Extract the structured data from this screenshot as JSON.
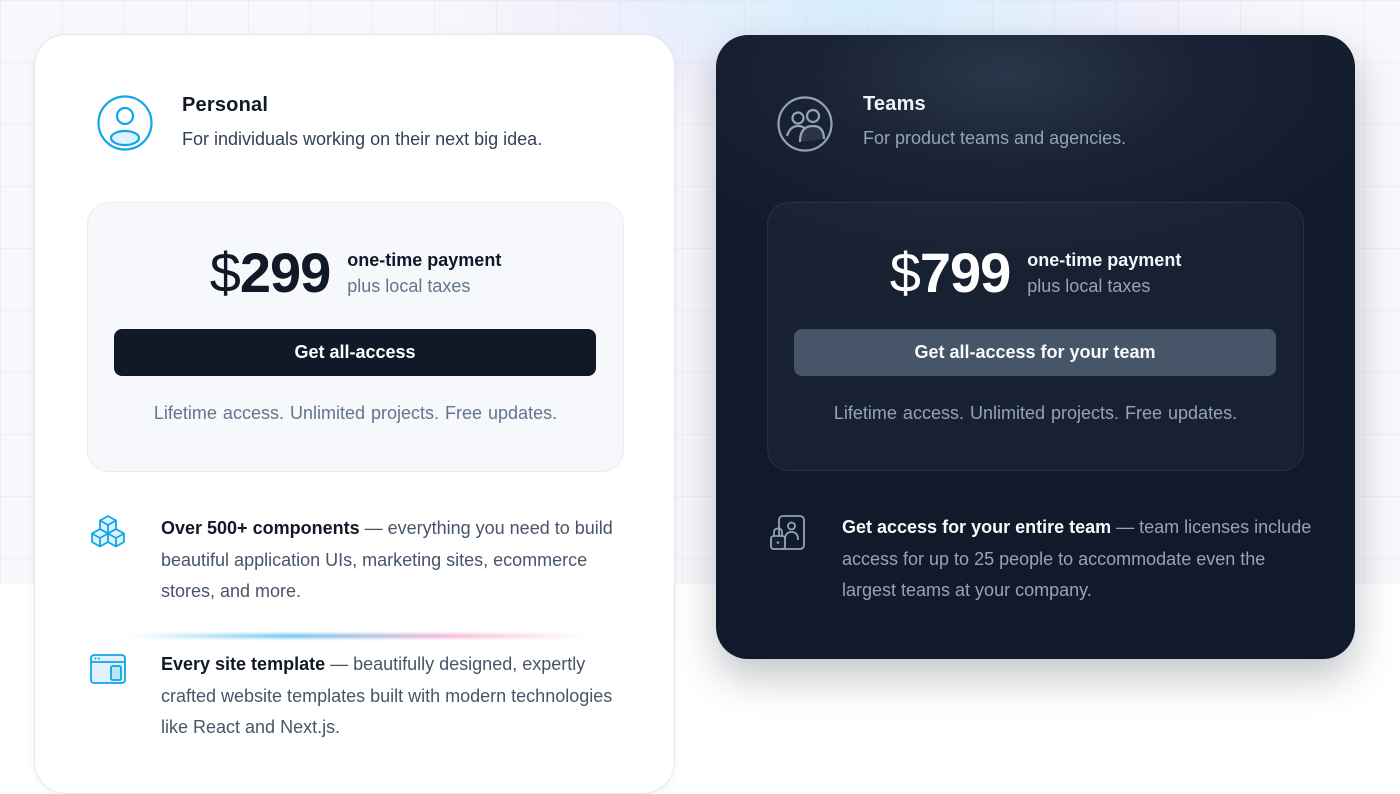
{
  "plans": [
    {
      "icon": "user-circle-icon",
      "title": "Personal",
      "description": "For individuals working on their next big idea.",
      "currency": "$",
      "price": "299",
      "payment_type": "one-time payment",
      "tax_note": "plus local taxes",
      "cta_label": "Get all-access",
      "perks": "Lifetime access.  Unlimited projects.  Free updates.",
      "features": [
        {
          "icon": "cubes-icon",
          "title": "Over 500+ components",
          "text": " — everything you need to build beautiful application UIs, marketing sites, ecommerce stores, and more."
        },
        {
          "icon": "browser-window-icon",
          "title": "Every site template",
          "text": " — beautifully designed, expertly crafted website templates built with modern technologies like React and Next.js."
        }
      ]
    },
    {
      "icon": "user-group-icon",
      "title": "Teams",
      "description": "For product teams and agencies.",
      "currency": "$",
      "price": "799",
      "payment_type": "one-time payment",
      "tax_note": "plus local taxes",
      "cta_label": "Get all-access for your team",
      "perks": "Lifetime access.  Unlimited projects.  Free updates.",
      "features": [
        {
          "icon": "team-license-icon",
          "title": "Get access for your entire team",
          "text": " — team licenses include access for up to 25 people to accommodate even the largest teams at your company."
        }
      ]
    }
  ],
  "colors": {
    "accent": "#0ea5e9",
    "dark_card": "#111a2b",
    "button_dark": "#111827",
    "button_muted": "#475569"
  }
}
